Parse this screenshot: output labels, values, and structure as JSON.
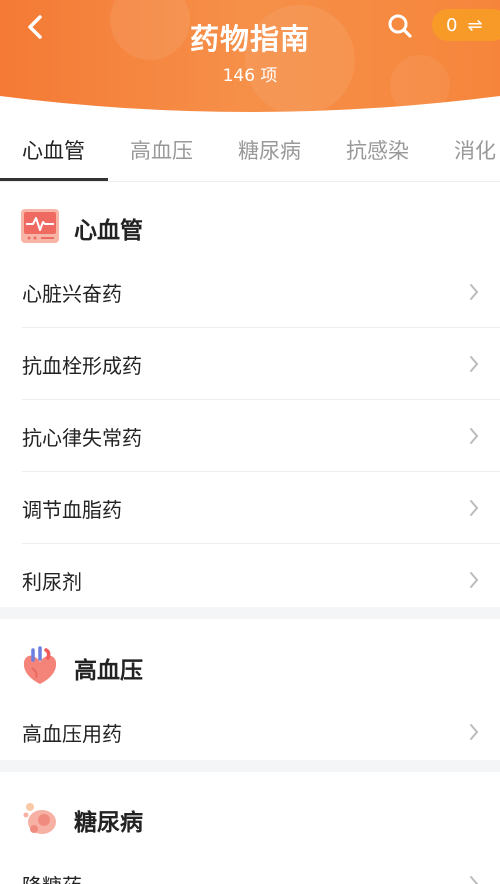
{
  "header": {
    "title": "药物指南",
    "subtitle": "146 项",
    "compare_count": "0",
    "compare_icon": "⇌"
  },
  "tabs": [
    {
      "label": "心血管",
      "active": true
    },
    {
      "label": "高血压",
      "active": false
    },
    {
      "label": "糖尿病",
      "active": false
    },
    {
      "label": "抗感染",
      "active": false
    },
    {
      "label": "消化",
      "active": false
    }
  ],
  "sections": [
    {
      "title": "心血管",
      "icon": "heart-monitor-icon",
      "items": [
        "心脏兴奋药",
        "抗血栓形成药",
        "抗心律失常药",
        "调节血脂药",
        "利尿剂"
      ]
    },
    {
      "title": "高血压",
      "icon": "heart-organ-icon",
      "items": [
        "高血压用药"
      ]
    },
    {
      "title": "糖尿病",
      "icon": "cells-icon",
      "items": [
        "降糖药"
      ]
    }
  ],
  "colors": {
    "header_orange": "#f6853b",
    "header_light": "#fab07a",
    "compare_pill": "#f79a28",
    "section_gap": "#f4f5f7"
  }
}
